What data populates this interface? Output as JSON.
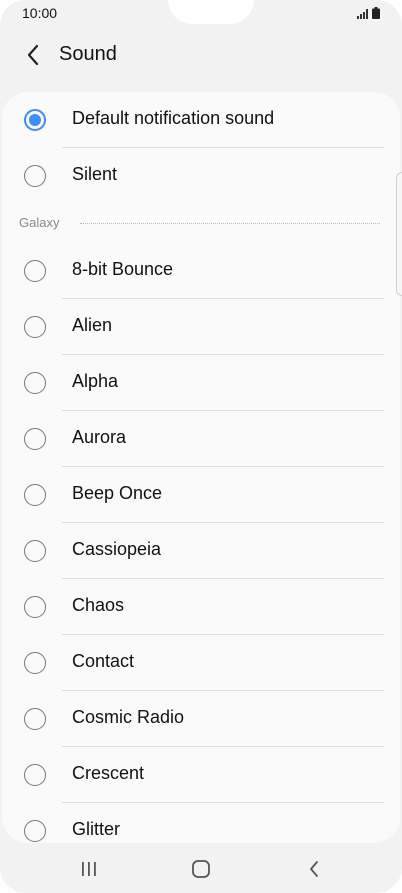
{
  "status_bar": {
    "time": "10:00"
  },
  "header": {
    "title": "Sound"
  },
  "options_top": [
    {
      "label": "Default notification sound",
      "checked": true
    },
    {
      "label": "Silent",
      "checked": false
    }
  ],
  "section": {
    "label": "Galaxy"
  },
  "options_galaxy": [
    {
      "label": "8-bit Bounce",
      "checked": false
    },
    {
      "label": "Alien",
      "checked": false
    },
    {
      "label": "Alpha",
      "checked": false
    },
    {
      "label": "Aurora",
      "checked": false
    },
    {
      "label": "Beep Once",
      "checked": false
    },
    {
      "label": "Cassiopeia",
      "checked": false
    },
    {
      "label": "Chaos",
      "checked": false
    },
    {
      "label": "Contact",
      "checked": false
    },
    {
      "label": "Cosmic Radio",
      "checked": false
    },
    {
      "label": "Crescent",
      "checked": false
    },
    {
      "label": "Glitter",
      "checked": false
    }
  ],
  "colors": {
    "accent": "#3e8ef7",
    "background": "#f2f2f2",
    "card": "#fafafa"
  },
  "icons": {
    "back": "chevron-left-icon",
    "signal": "signal-icon",
    "battery": "battery-icon",
    "recents": "recents-icon",
    "home": "home-icon",
    "nav_back": "nav-back-icon"
  }
}
